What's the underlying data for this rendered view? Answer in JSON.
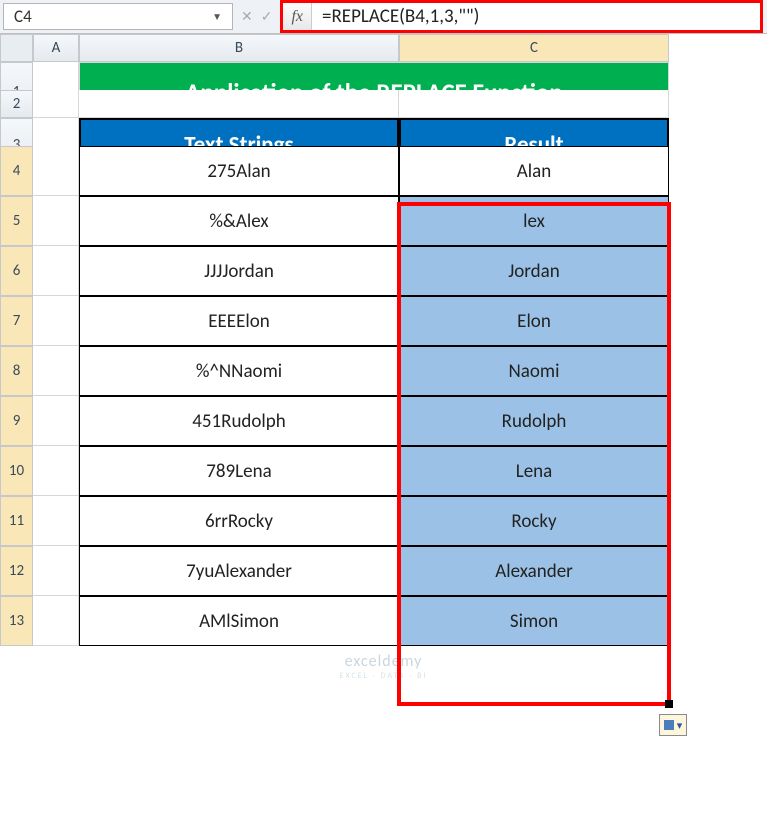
{
  "nameBox": "C4",
  "fxLabel": "fx",
  "formula": "=REPLACE(B4,1,3,\"\")",
  "columns": [
    "A",
    "B",
    "C"
  ],
  "title": "Application of the REPLACE Function",
  "headers": {
    "b": "Text Strings",
    "c": "Result"
  },
  "rows": [
    {
      "n": 4,
      "b": "275Alan",
      "c": "Alan"
    },
    {
      "n": 5,
      "b": "%&Alex",
      "c": "lex"
    },
    {
      "n": 6,
      "b": "JJJJordan",
      "c": "Jordan"
    },
    {
      "n": 7,
      "b": "EEEElon",
      "c": "Elon"
    },
    {
      "n": 8,
      "b": "%^NNaomi",
      "c": "Naomi"
    },
    {
      "n": 9,
      "b": "451Rudolph",
      "c": "Rudolph"
    },
    {
      "n": 10,
      "b": "789Lena",
      "c": "Lena"
    },
    {
      "n": 11,
      "b": "6rrRocky",
      "c": "Rocky"
    },
    {
      "n": 12,
      "b": "7yuAlexander",
      "c": "Alexander"
    },
    {
      "n": 13,
      "b": "AMlSimon",
      "c": "Simon"
    }
  ],
  "watermark": {
    "brand": "exceldemy",
    "tag": "EXCEL · DATA · BI"
  }
}
